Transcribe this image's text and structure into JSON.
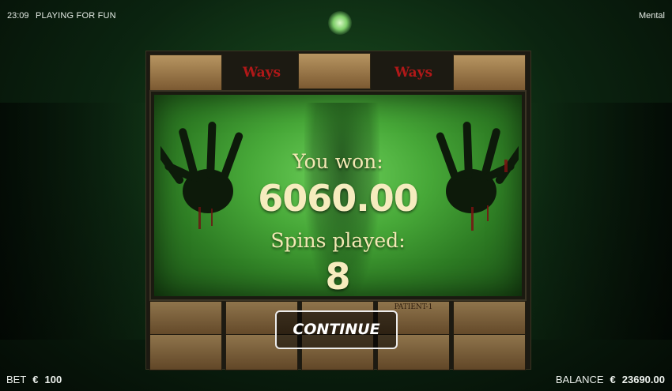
{
  "topbar": {
    "time": "23:09",
    "mode": "PLAYING FOR FUN",
    "game_name": "Mental"
  },
  "reels": {
    "top_row": [
      "",
      "Ways",
      "",
      "Ways",
      ""
    ],
    "bottom_label": "PATIENT-1"
  },
  "win_panel": {
    "won_label": "You won:",
    "won_amount": "6060.00",
    "spins_label": "Spins played:",
    "spins_value": "8"
  },
  "continue_button": {
    "label": "CONTINUE"
  },
  "footer": {
    "bet_label": "BET",
    "bet_currency": "€",
    "bet_value": "100",
    "balance_label": "BALANCE",
    "balance_currency": "€",
    "balance_value": "23690.00"
  },
  "colors": {
    "panel_green": "#47a838",
    "text_cream": "#f3e8b4",
    "background": "#0a140b"
  }
}
